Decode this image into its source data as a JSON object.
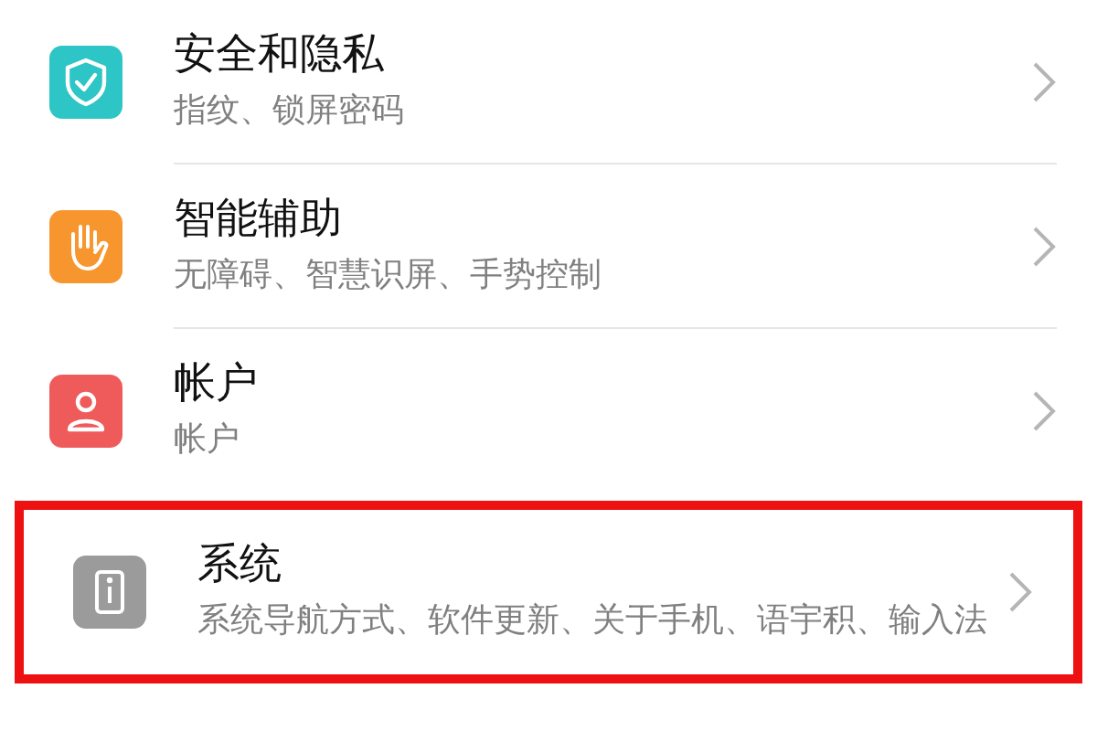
{
  "items": [
    {
      "kind": "shield",
      "color": "#2ec5c6",
      "title": "安全和隐私",
      "subtitle": "指纹、锁屏密码",
      "highlighted": false
    },
    {
      "kind": "hand",
      "color": "#f7962f",
      "title": "智能辅助",
      "subtitle": "无障碍、智慧识屏、手势控制",
      "highlighted": false
    },
    {
      "kind": "person",
      "color": "#ef5b5b",
      "title": "帐户",
      "subtitle": "帐户",
      "highlighted": false
    },
    {
      "kind": "info",
      "color": "#9b9b9b",
      "title": "系统",
      "subtitle": "系统导航方式、软件更新、关于手机、语宇积、输入法",
      "highlighted": true
    }
  ]
}
